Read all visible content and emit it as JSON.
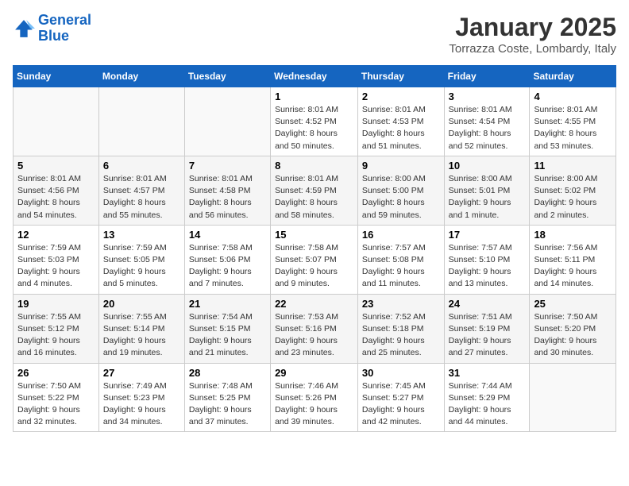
{
  "header": {
    "logo_line1": "General",
    "logo_line2": "Blue",
    "month": "January 2025",
    "location": "Torrazza Coste, Lombardy, Italy"
  },
  "weekdays": [
    "Sunday",
    "Monday",
    "Tuesday",
    "Wednesday",
    "Thursday",
    "Friday",
    "Saturday"
  ],
  "weeks": [
    [
      {
        "day": "",
        "info": ""
      },
      {
        "day": "",
        "info": ""
      },
      {
        "day": "",
        "info": ""
      },
      {
        "day": "1",
        "info": "Sunrise: 8:01 AM\nSunset: 4:52 PM\nDaylight: 8 hours\nand 50 minutes."
      },
      {
        "day": "2",
        "info": "Sunrise: 8:01 AM\nSunset: 4:53 PM\nDaylight: 8 hours\nand 51 minutes."
      },
      {
        "day": "3",
        "info": "Sunrise: 8:01 AM\nSunset: 4:54 PM\nDaylight: 8 hours\nand 52 minutes."
      },
      {
        "day": "4",
        "info": "Sunrise: 8:01 AM\nSunset: 4:55 PM\nDaylight: 8 hours\nand 53 minutes."
      }
    ],
    [
      {
        "day": "5",
        "info": "Sunrise: 8:01 AM\nSunset: 4:56 PM\nDaylight: 8 hours\nand 54 minutes."
      },
      {
        "day": "6",
        "info": "Sunrise: 8:01 AM\nSunset: 4:57 PM\nDaylight: 8 hours\nand 55 minutes."
      },
      {
        "day": "7",
        "info": "Sunrise: 8:01 AM\nSunset: 4:58 PM\nDaylight: 8 hours\nand 56 minutes."
      },
      {
        "day": "8",
        "info": "Sunrise: 8:01 AM\nSunset: 4:59 PM\nDaylight: 8 hours\nand 58 minutes."
      },
      {
        "day": "9",
        "info": "Sunrise: 8:00 AM\nSunset: 5:00 PM\nDaylight: 8 hours\nand 59 minutes."
      },
      {
        "day": "10",
        "info": "Sunrise: 8:00 AM\nSunset: 5:01 PM\nDaylight: 9 hours\nand 1 minute."
      },
      {
        "day": "11",
        "info": "Sunrise: 8:00 AM\nSunset: 5:02 PM\nDaylight: 9 hours\nand 2 minutes."
      }
    ],
    [
      {
        "day": "12",
        "info": "Sunrise: 7:59 AM\nSunset: 5:03 PM\nDaylight: 9 hours\nand 4 minutes."
      },
      {
        "day": "13",
        "info": "Sunrise: 7:59 AM\nSunset: 5:05 PM\nDaylight: 9 hours\nand 5 minutes."
      },
      {
        "day": "14",
        "info": "Sunrise: 7:58 AM\nSunset: 5:06 PM\nDaylight: 9 hours\nand 7 minutes."
      },
      {
        "day": "15",
        "info": "Sunrise: 7:58 AM\nSunset: 5:07 PM\nDaylight: 9 hours\nand 9 minutes."
      },
      {
        "day": "16",
        "info": "Sunrise: 7:57 AM\nSunset: 5:08 PM\nDaylight: 9 hours\nand 11 minutes."
      },
      {
        "day": "17",
        "info": "Sunrise: 7:57 AM\nSunset: 5:10 PM\nDaylight: 9 hours\nand 13 minutes."
      },
      {
        "day": "18",
        "info": "Sunrise: 7:56 AM\nSunset: 5:11 PM\nDaylight: 9 hours\nand 14 minutes."
      }
    ],
    [
      {
        "day": "19",
        "info": "Sunrise: 7:55 AM\nSunset: 5:12 PM\nDaylight: 9 hours\nand 16 minutes."
      },
      {
        "day": "20",
        "info": "Sunrise: 7:55 AM\nSunset: 5:14 PM\nDaylight: 9 hours\nand 19 minutes."
      },
      {
        "day": "21",
        "info": "Sunrise: 7:54 AM\nSunset: 5:15 PM\nDaylight: 9 hours\nand 21 minutes."
      },
      {
        "day": "22",
        "info": "Sunrise: 7:53 AM\nSunset: 5:16 PM\nDaylight: 9 hours\nand 23 minutes."
      },
      {
        "day": "23",
        "info": "Sunrise: 7:52 AM\nSunset: 5:18 PM\nDaylight: 9 hours\nand 25 minutes."
      },
      {
        "day": "24",
        "info": "Sunrise: 7:51 AM\nSunset: 5:19 PM\nDaylight: 9 hours\nand 27 minutes."
      },
      {
        "day": "25",
        "info": "Sunrise: 7:50 AM\nSunset: 5:20 PM\nDaylight: 9 hours\nand 30 minutes."
      }
    ],
    [
      {
        "day": "26",
        "info": "Sunrise: 7:50 AM\nSunset: 5:22 PM\nDaylight: 9 hours\nand 32 minutes."
      },
      {
        "day": "27",
        "info": "Sunrise: 7:49 AM\nSunset: 5:23 PM\nDaylight: 9 hours\nand 34 minutes."
      },
      {
        "day": "28",
        "info": "Sunrise: 7:48 AM\nSunset: 5:25 PM\nDaylight: 9 hours\nand 37 minutes."
      },
      {
        "day": "29",
        "info": "Sunrise: 7:46 AM\nSunset: 5:26 PM\nDaylight: 9 hours\nand 39 minutes."
      },
      {
        "day": "30",
        "info": "Sunrise: 7:45 AM\nSunset: 5:27 PM\nDaylight: 9 hours\nand 42 minutes."
      },
      {
        "day": "31",
        "info": "Sunrise: 7:44 AM\nSunset: 5:29 PM\nDaylight: 9 hours\nand 44 minutes."
      },
      {
        "day": "",
        "info": ""
      }
    ]
  ]
}
